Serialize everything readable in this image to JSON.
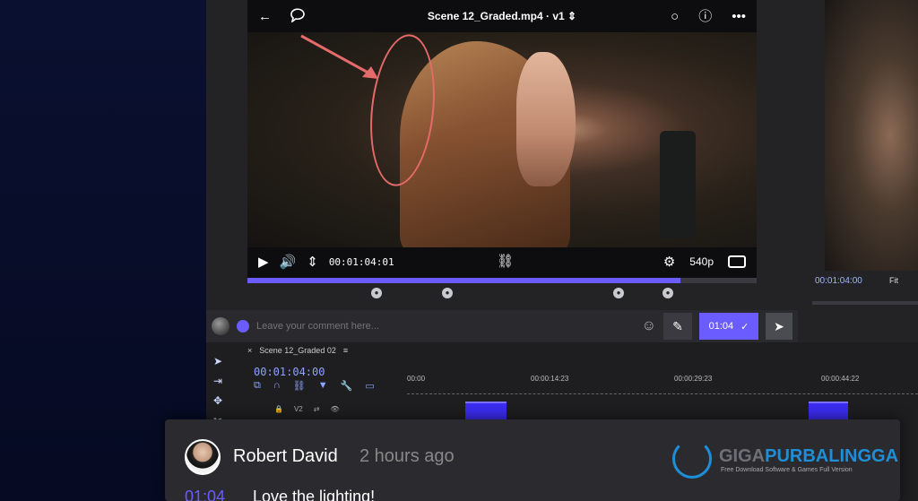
{
  "player": {
    "title": "Scene 12_Graded.mp4 · v1 ⇕",
    "timecode": "00:01:04:01",
    "quality": "540p",
    "progress": 0.85
  },
  "comment_bar": {
    "placeholder": "Leave your comment here...",
    "timestamp": "01:04"
  },
  "right_panel": {
    "timecode": "00:01:04:00",
    "fit": "Fit"
  },
  "timeline": {
    "sequence": "Scene 12_Graded 02",
    "timecode": "00:01:04:00",
    "ruler": [
      "00:00",
      "00:00:14:23",
      "00:00:29:23",
      "00:00:44:22"
    ],
    "track": "V2"
  },
  "comment_card": {
    "author": "Robert David",
    "time_ago": "2 hours ago",
    "timestamp": "01:04",
    "text": "Love the lighting!"
  },
  "watermark": {
    "brand_left": "GIGA",
    "brand_right": "PURBALINGGA",
    "tagline": "Free Download Software & Games Full Version"
  },
  "colors": {
    "accent": "#6b5cff",
    "annotation": "#e56a6a"
  }
}
